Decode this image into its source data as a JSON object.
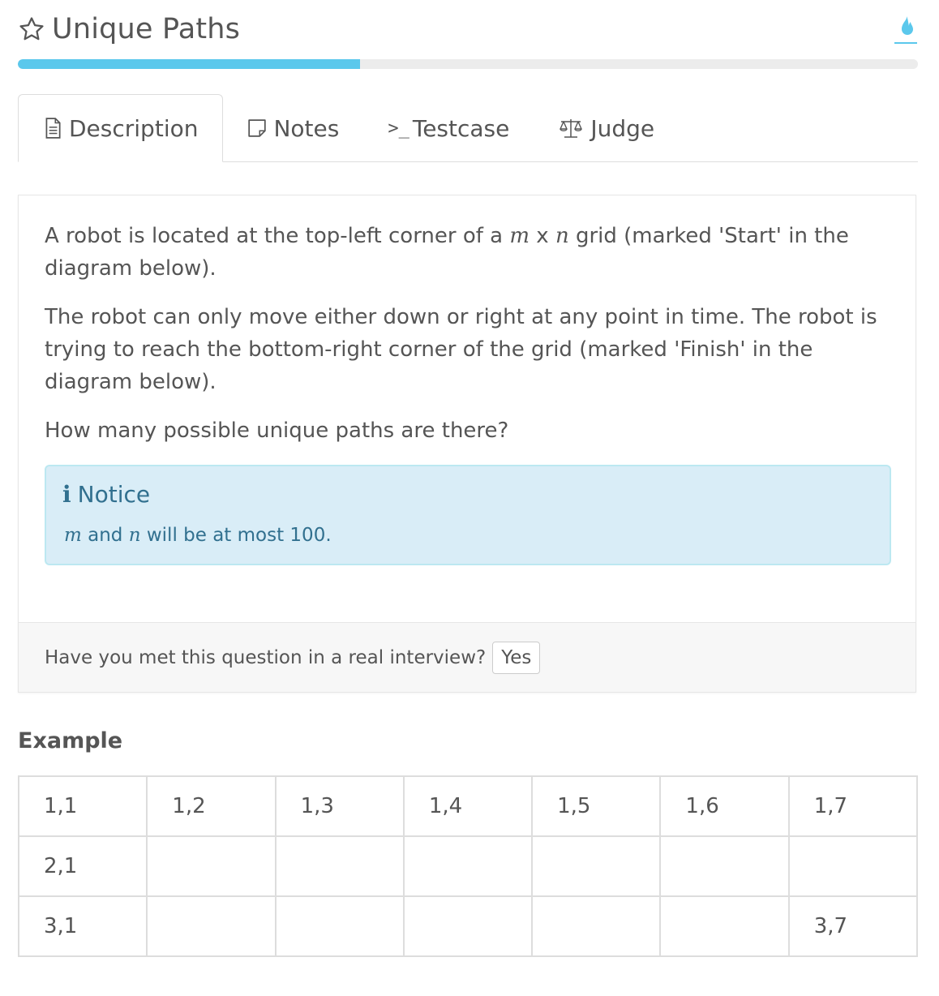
{
  "header": {
    "title": "Unique Paths",
    "progress_fraction": 0.38,
    "accent_color": "#5bc8ec",
    "star_icon": "star-outline-icon",
    "flame_icon": "flame-icon"
  },
  "tabs": [
    {
      "label": "Description",
      "icon": "document-icon",
      "active": true
    },
    {
      "label": "Notes",
      "icon": "note-icon",
      "active": false
    },
    {
      "label": "Testcase",
      "icon": ">_",
      "active": false
    },
    {
      "label": "Judge",
      "icon": "scales-icon",
      "active": false
    }
  ],
  "description": {
    "p1_before": "A robot is located at the top-left corner of a ",
    "p1_m": "m",
    "p1_x": " x ",
    "p1_n": "n",
    "p1_after": " grid (marked 'Start' in the diagram below).",
    "p2": "The robot can only move either down or right at any point in time. The robot is trying to reach the bottom-right corner of the grid (marked 'Finish' in the diagram below).",
    "p3": "How many possible unique paths are there?"
  },
  "notice": {
    "icon": "i",
    "title": "Notice",
    "m": "m",
    "and": " and ",
    "n": "n",
    "rest": " will be at most 100."
  },
  "footer": {
    "question": "Have you met this question in a real interview?",
    "yes_label": "Yes"
  },
  "example": {
    "title": "Example",
    "rows": [
      [
        "1,1",
        "1,2",
        "1,3",
        "1,4",
        "1,5",
        "1,6",
        "1,7"
      ],
      [
        "2,1",
        "",
        "",
        "",
        "",
        "",
        ""
      ],
      [
        "3,1",
        "",
        "",
        "",
        "",
        "",
        "3,7"
      ]
    ]
  }
}
